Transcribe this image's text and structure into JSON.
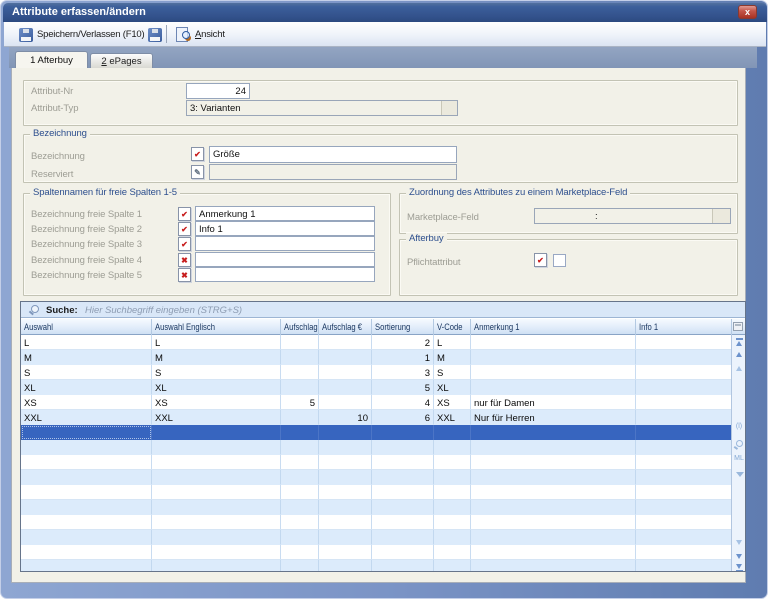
{
  "window": {
    "title": "Attribute erfassen/ändern"
  },
  "toolbar": {
    "save_exit_label": "Speichern/Verlassen (F10)",
    "view_accel": "A",
    "view_rest": "nsicht"
  },
  "tabs": {
    "tab1_label": "1 Afterbuy",
    "tab2_accel": "2",
    "tab2_rest": " ePages"
  },
  "form": {
    "attribut_nr": {
      "label": "Attribut-Nr",
      "value": "24"
    },
    "attribut_typ": {
      "label": "Attribut-Typ",
      "value": "3: Varianten"
    },
    "bezeichnung_group": {
      "title": "Bezeichnung",
      "bezeichnung_label": "Bezeichnung",
      "bezeichnung_value": "Größe",
      "reserviert_label": "Reserviert",
      "reserviert_value": ""
    },
    "spalten_group": {
      "title": "Spaltennamen für freie Spalten 1-5",
      "rows": [
        {
          "label": "Bezeichnung freie Spalte 1",
          "icon": "check",
          "value": "Anmerkung 1"
        },
        {
          "label": "Bezeichnung freie Spalte 2",
          "icon": "check",
          "value": "Info 1"
        },
        {
          "label": "Bezeichnung freie Spalte 3",
          "icon": "check",
          "value": ""
        },
        {
          "label": "Bezeichnung freie Spalte 4",
          "icon": "cross",
          "value": ""
        },
        {
          "label": "Bezeichnung freie Spalte 5",
          "icon": "cross",
          "value": ""
        }
      ]
    },
    "zuordnung_group": {
      "title": "Zuordnung des Attributes zu einem Marketplace-Feld",
      "marketplace_label": "Marketplace-Feld",
      "marketplace_value": ":"
    },
    "afterbuy_group": {
      "title": "Afterbuy",
      "pflicht_label": "Pflichtattribut",
      "pflicht_checked": false
    }
  },
  "grid": {
    "search_label": "Suche:",
    "search_placeholder": "Hier Suchbegriff eingeben (STRG+S)",
    "columns": [
      "Auswahl",
      "Auswahl Englisch",
      "Aufschlag",
      "Aufschlag €",
      "Sortierung",
      "V-Code",
      "Anmerkung 1",
      "Info 1"
    ],
    "rows": [
      [
        "L",
        "L",
        "",
        "",
        "2",
        "L",
        "",
        ""
      ],
      [
        "M",
        "M",
        "",
        "",
        "1",
        "M",
        "",
        ""
      ],
      [
        "S",
        "S",
        "",
        "",
        "3",
        "S",
        "",
        ""
      ],
      [
        "XL",
        "XL",
        "",
        "",
        "5",
        "XL",
        "",
        ""
      ],
      [
        "XS",
        "XS",
        "5",
        "",
        "4",
        "XS",
        "nur für Damen",
        ""
      ],
      [
        "XXL",
        "XXL",
        "",
        "10",
        "6",
        "XXL",
        "Nur für Herren",
        ""
      ]
    ],
    "selected_row": "new-empty-row"
  }
}
